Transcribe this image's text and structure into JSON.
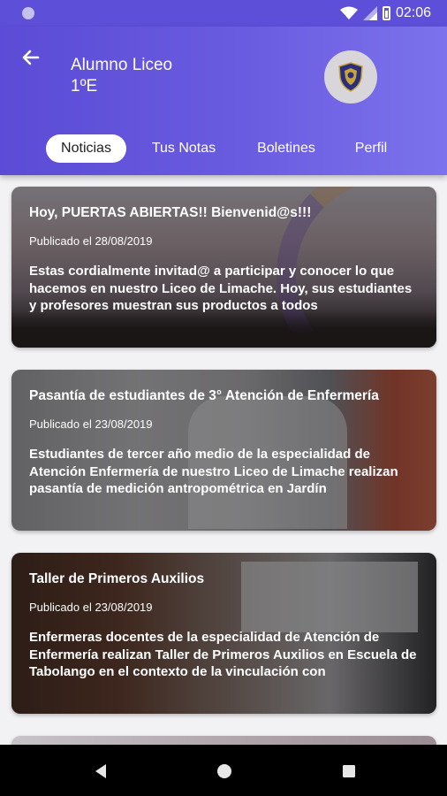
{
  "status_bar": {
    "time": "02:06"
  },
  "header": {
    "student_name": "Alumno Liceo",
    "grade": "1ºE"
  },
  "tabs": [
    {
      "label": "Noticias",
      "active": true
    },
    {
      "label": "Tus Notas",
      "active": false
    },
    {
      "label": "Boletines",
      "active": false
    },
    {
      "label": "Perfil",
      "active": false
    }
  ],
  "news": [
    {
      "title": "Hoy, PUERTAS ABIERTAS!! Bienvenid@s!!!",
      "date": "Publicado el 28/08/2019",
      "summary": "Estas cordialmente invitad@ a participar y conocer lo que hacemos en nuestro Liceo de Limache. Hoy, sus estudiantes y profesores muestran sus productos a todos"
    },
    {
      "title": "Pasantía de estudiantes de 3° Atención de Enfermería",
      "date": "Publicado el 23/08/2019",
      "summary": "Estudiantes de tercer año medio de la especialidad de Atención Enfermería de nuestro Liceo de Limache realizan pasantía de medición antropométrica en Jardín"
    },
    {
      "title": "Taller de Primeros Auxilios",
      "date": "Publicado el 23/08/2019",
      "summary": "Enfermeras docentes de la especialidad de Atención de Enfermería realizan Taller de Primeros Auxilios en Escuela de Tabolango en el contexto de la vinculación con"
    }
  ],
  "colors": {
    "header_start": "#5b4bd6",
    "header_end": "#7c72ec",
    "status_bar": "#5d4fd8"
  },
  "icons": {
    "back": "arrow-left-icon",
    "avatar": "school-crest-icon",
    "nav_back": "triangle-back-icon",
    "nav_home": "circle-home-icon",
    "nav_recent": "square-recent-icon"
  }
}
